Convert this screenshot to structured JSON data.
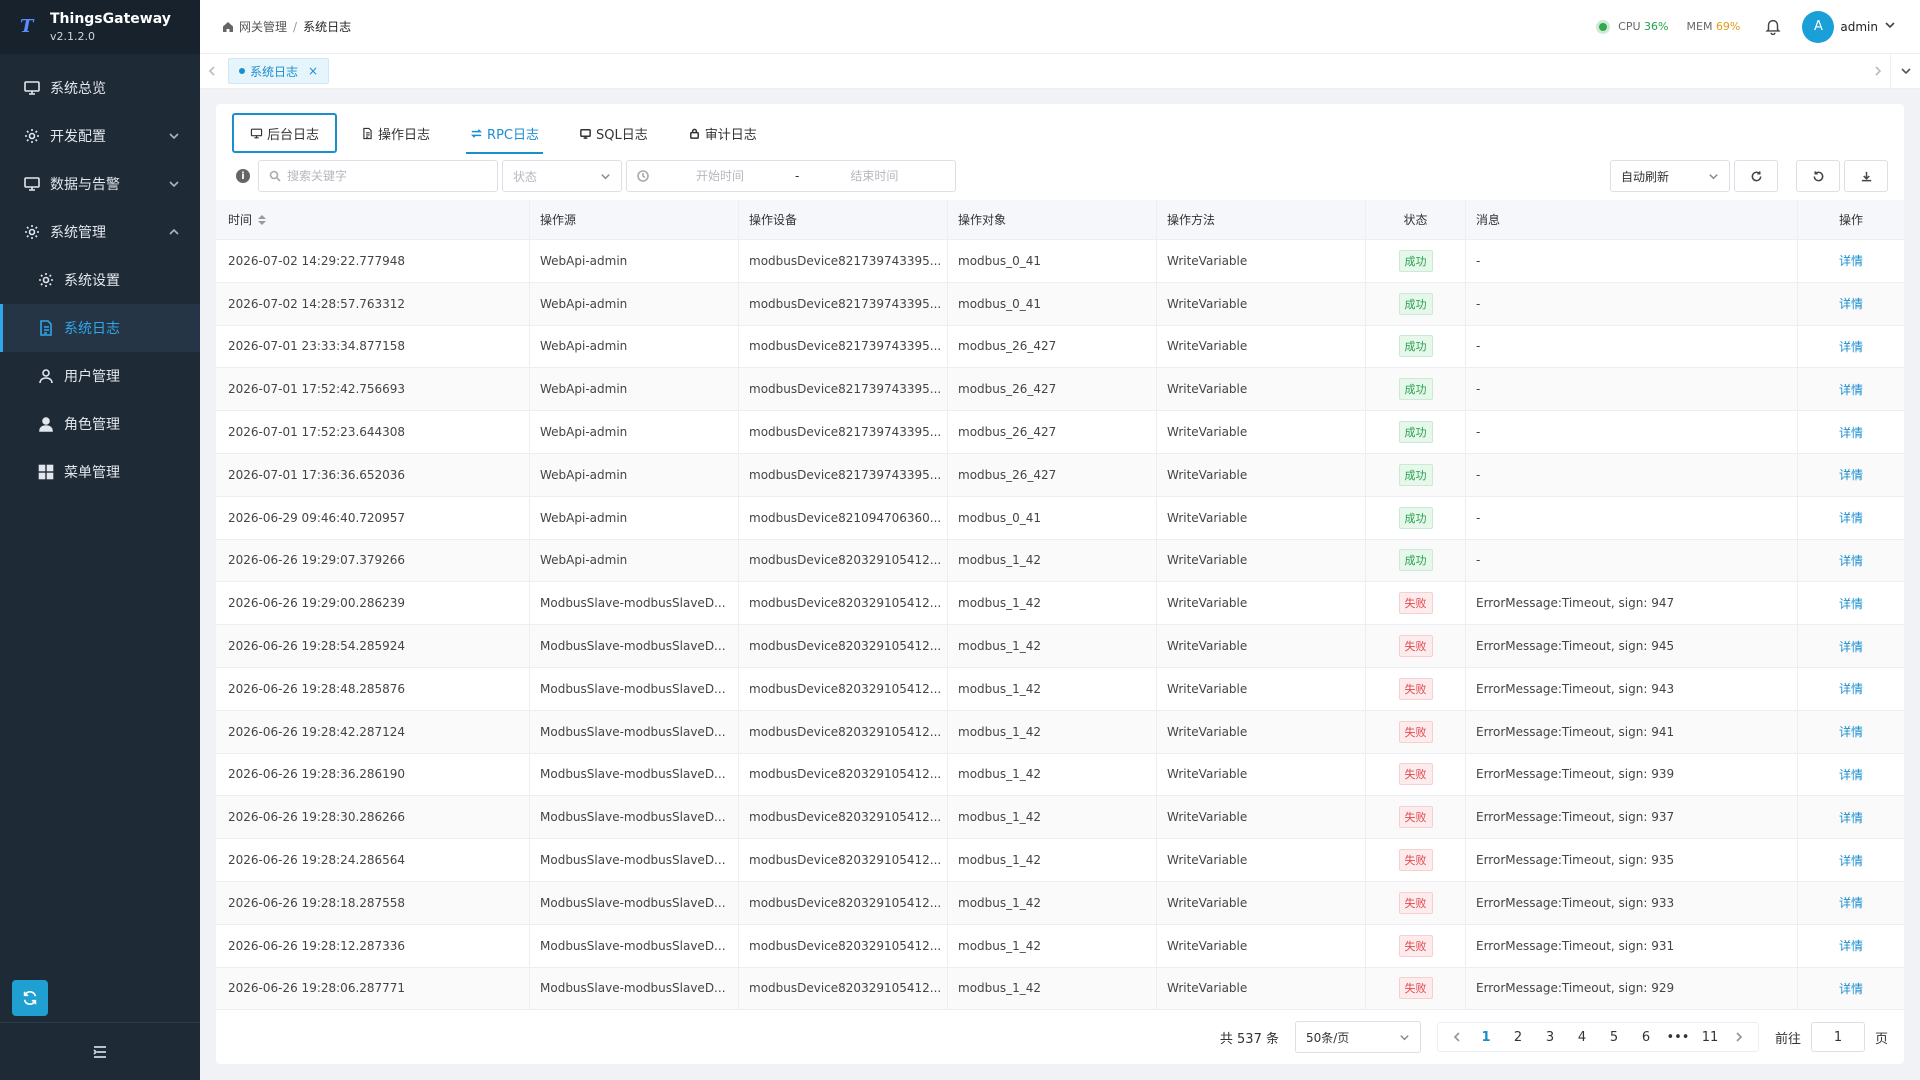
{
  "app": {
    "name": "ThingsGateway",
    "version": "v2.1.2.0",
    "logo_letter": "T"
  },
  "sidebar": {
    "items": [
      {
        "label": "系统总览",
        "icon": "monitor-icon",
        "expandable": false
      },
      {
        "label": "开发配置",
        "icon": "gear-icon",
        "expandable": true
      },
      {
        "label": "数据与告警",
        "icon": "monitor-icon",
        "expandable": true
      },
      {
        "label": "系统管理",
        "icon": "gear-icon",
        "expandable": true,
        "expanded": true
      }
    ],
    "subitems": [
      {
        "label": "系统设置",
        "icon": "gear-icon"
      },
      {
        "label": "系统日志",
        "icon": "document-icon",
        "active": true
      },
      {
        "label": "用户管理",
        "icon": "user-icon"
      },
      {
        "label": "角色管理",
        "icon": "user-solid-icon"
      },
      {
        "label": "菜单管理",
        "icon": "grid-icon"
      }
    ]
  },
  "header": {
    "breadcrumb": [
      "网关管理",
      "系统日志"
    ],
    "cpu_label": "CPU",
    "cpu_value": "36%",
    "mem_label": "MEM",
    "mem_value": "69%",
    "avatar_letter": "A",
    "user": "admin",
    "colors": {
      "cpu": "#22a34a",
      "mem": "#e09b15",
      "accent": "#1a8fd0"
    }
  },
  "tabbar": {
    "tabs": [
      {
        "label": "系统日志",
        "close": "×"
      }
    ]
  },
  "log_tabs": [
    {
      "label": "后台日志",
      "icon": "monitor-icon"
    },
    {
      "label": "操作日志",
      "icon": "document-icon"
    },
    {
      "label": "RPC日志",
      "icon": "rpc-icon",
      "active": true
    },
    {
      "label": "SQL日志",
      "icon": "database-icon"
    },
    {
      "label": "审计日志",
      "icon": "lock-icon"
    }
  ],
  "filters": {
    "info_glyph": "i",
    "search_placeholder": "搜索关键字",
    "status_placeholder": "状态",
    "start_placeholder": "开始时间",
    "range_sep": "-",
    "end_placeholder": "结束时间",
    "auto_refresh": "自动刷新"
  },
  "table": {
    "columns": {
      "time": "时间",
      "source": "操作源",
      "device": "操作设备",
      "object": "操作对象",
      "method": "操作方法",
      "status": "状态",
      "message": "消息",
      "action": "操作"
    },
    "detail_label": "详情",
    "rows": [
      {
        "time": "2026-07-02 14:29:22.777948",
        "source": "WebApi-admin",
        "device": "modbusDevice821739743395...",
        "object": "modbus_0_41",
        "method": "WriteVariable",
        "status": "成功",
        "ok": true,
        "message": "-"
      },
      {
        "time": "2026-07-02 14:28:57.763312",
        "source": "WebApi-admin",
        "device": "modbusDevice821739743395...",
        "object": "modbus_0_41",
        "method": "WriteVariable",
        "status": "成功",
        "ok": true,
        "message": "-"
      },
      {
        "time": "2026-07-01 23:33:34.877158",
        "source": "WebApi-admin",
        "device": "modbusDevice821739743395...",
        "object": "modbus_26_427",
        "method": "WriteVariable",
        "status": "成功",
        "ok": true,
        "message": "-"
      },
      {
        "time": "2026-07-01 17:52:42.756693",
        "source": "WebApi-admin",
        "device": "modbusDevice821739743395...",
        "object": "modbus_26_427",
        "method": "WriteVariable",
        "status": "成功",
        "ok": true,
        "message": "-"
      },
      {
        "time": "2026-07-01 17:52:23.644308",
        "source": "WebApi-admin",
        "device": "modbusDevice821739743395...",
        "object": "modbus_26_427",
        "method": "WriteVariable",
        "status": "成功",
        "ok": true,
        "message": "-"
      },
      {
        "time": "2026-07-01 17:36:36.652036",
        "source": "WebApi-admin",
        "device": "modbusDevice821739743395...",
        "object": "modbus_26_427",
        "method": "WriteVariable",
        "status": "成功",
        "ok": true,
        "message": "-"
      },
      {
        "time": "2026-06-29 09:46:40.720957",
        "source": "WebApi-admin",
        "device": "modbusDevice821094706360...",
        "object": "modbus_0_41",
        "method": "WriteVariable",
        "status": "成功",
        "ok": true,
        "message": "-"
      },
      {
        "time": "2026-06-26 19:29:07.379266",
        "source": "WebApi-admin",
        "device": "modbusDevice820329105412...",
        "object": "modbus_1_42",
        "method": "WriteVariable",
        "status": "成功",
        "ok": true,
        "message": "-"
      },
      {
        "time": "2026-06-26 19:29:00.286239",
        "source": "ModbusSlave-modbusSlaveD...",
        "device": "modbusDevice820329105412...",
        "object": "modbus_1_42",
        "method": "WriteVariable",
        "status": "失败",
        "ok": false,
        "message": "ErrorMessage:Timeout, sign: 947"
      },
      {
        "time": "2026-06-26 19:28:54.285924",
        "source": "ModbusSlave-modbusSlaveD...",
        "device": "modbusDevice820329105412...",
        "object": "modbus_1_42",
        "method": "WriteVariable",
        "status": "失败",
        "ok": false,
        "message": "ErrorMessage:Timeout, sign: 945"
      },
      {
        "time": "2026-06-26 19:28:48.285876",
        "source": "ModbusSlave-modbusSlaveD...",
        "device": "modbusDevice820329105412...",
        "object": "modbus_1_42",
        "method": "WriteVariable",
        "status": "失败",
        "ok": false,
        "message": "ErrorMessage:Timeout, sign: 943"
      },
      {
        "time": "2026-06-26 19:28:42.287124",
        "source": "ModbusSlave-modbusSlaveD...",
        "device": "modbusDevice820329105412...",
        "object": "modbus_1_42",
        "method": "WriteVariable",
        "status": "失败",
        "ok": false,
        "message": "ErrorMessage:Timeout, sign: 941"
      },
      {
        "time": "2026-06-26 19:28:36.286190",
        "source": "ModbusSlave-modbusSlaveD...",
        "device": "modbusDevice820329105412...",
        "object": "modbus_1_42",
        "method": "WriteVariable",
        "status": "失败",
        "ok": false,
        "message": "ErrorMessage:Timeout, sign: 939"
      },
      {
        "time": "2026-06-26 19:28:30.286266",
        "source": "ModbusSlave-modbusSlaveD...",
        "device": "modbusDevice820329105412...",
        "object": "modbus_1_42",
        "method": "WriteVariable",
        "status": "失败",
        "ok": false,
        "message": "ErrorMessage:Timeout, sign: 937"
      },
      {
        "time": "2026-06-26 19:28:24.286564",
        "source": "ModbusSlave-modbusSlaveD...",
        "device": "modbusDevice820329105412...",
        "object": "modbus_1_42",
        "method": "WriteVariable",
        "status": "失败",
        "ok": false,
        "message": "ErrorMessage:Timeout, sign: 935"
      },
      {
        "time": "2026-06-26 19:28:18.287558",
        "source": "ModbusSlave-modbusSlaveD...",
        "device": "modbusDevice820329105412...",
        "object": "modbus_1_42",
        "method": "WriteVariable",
        "status": "失败",
        "ok": false,
        "message": "ErrorMessage:Timeout, sign: 933"
      },
      {
        "time": "2026-06-26 19:28:12.287336",
        "source": "ModbusSlave-modbusSlaveD...",
        "device": "modbusDevice820329105412...",
        "object": "modbus_1_42",
        "method": "WriteVariable",
        "status": "失败",
        "ok": false,
        "message": "ErrorMessage:Timeout, sign: 931"
      },
      {
        "time": "2026-06-26 19:28:06.287771",
        "source": "ModbusSlave-modbusSlaveD...",
        "device": "modbusDevice820329105412...",
        "object": "modbus_1_42",
        "method": "WriteVariable",
        "status": "失败",
        "ok": false,
        "message": "ErrorMessage:Timeout, sign: 929"
      }
    ]
  },
  "pagination": {
    "total": "共 537 条",
    "page_size": "50条/页",
    "pages": [
      "1",
      "2",
      "3",
      "4",
      "5",
      "6",
      "•••",
      "11"
    ],
    "current": "1",
    "goto_label": "前往",
    "goto_value": "1",
    "page_unit": "页"
  }
}
